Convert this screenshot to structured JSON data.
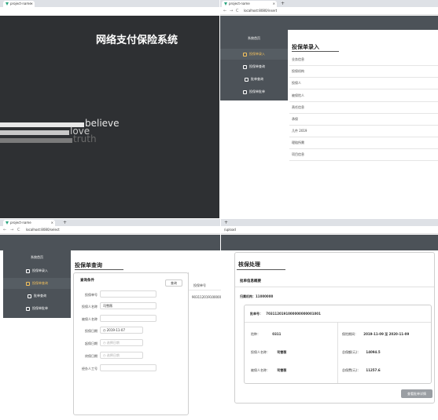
{
  "browser": {
    "tab_title": "project-name",
    "tab_close": "×",
    "new_tab": "+",
    "back": "←",
    "forward": "→",
    "reload": "C",
    "url_entry": "localhost:8080/insert",
    "url_select": "localhost:8080/select",
    "url_upload": "/upload"
  },
  "login": {
    "title": "网络支付保险系统",
    "words": [
      "believe",
      "love",
      "truth"
    ]
  },
  "sidebar": {
    "home": "系统首页",
    "items": [
      "投保单录入",
      "投保单查询",
      "批单查询",
      "投保单批单"
    ]
  },
  "entry_panel": {
    "title": "投保单录入",
    "fields": [
      "业务信息",
      "投保机构",
      "投保人",
      "被保险人",
      "责任信息",
      "承保",
      "几件 2019",
      "理赔所需",
      "项目信息"
    ]
  },
  "query_panel": {
    "title": "投保单查询",
    "card_title": "查询条件",
    "query_button": "查询",
    "labels": [
      "投保单号",
      "投保人名称",
      "被保人名称",
      "投保日期",
      "起保日期",
      "终保日期",
      "经办人工号"
    ],
    "insured_name_value": "司雪薇",
    "date_value": "2019-11-07",
    "date_placeholder": "选择日期",
    "result_header": "投保单号",
    "result_value": "9031120191000000"
  },
  "detail_panel": {
    "title": "核保处理",
    "section": "批单信息概要",
    "org_label": "归属机构：",
    "org_value": "11000000",
    "no_label": "批单号：",
    "no_value": "7031120191000000000001001",
    "agent_label": "险种：",
    "agent_value": "0311",
    "holder_label": "投保人名称：",
    "holder_value": "司雪薇",
    "insured_label": "被保人名称：",
    "insured_value": "司雪薇",
    "period_label": "保险期间：",
    "period_value": "2019-11-09 至 2020-11-09",
    "amount_label": "总保额(元)：",
    "amount_value": "14094.5",
    "premium_label": "总保费(元)：",
    "premium_value": "11257.6",
    "detail_button": "查看批单详情"
  }
}
